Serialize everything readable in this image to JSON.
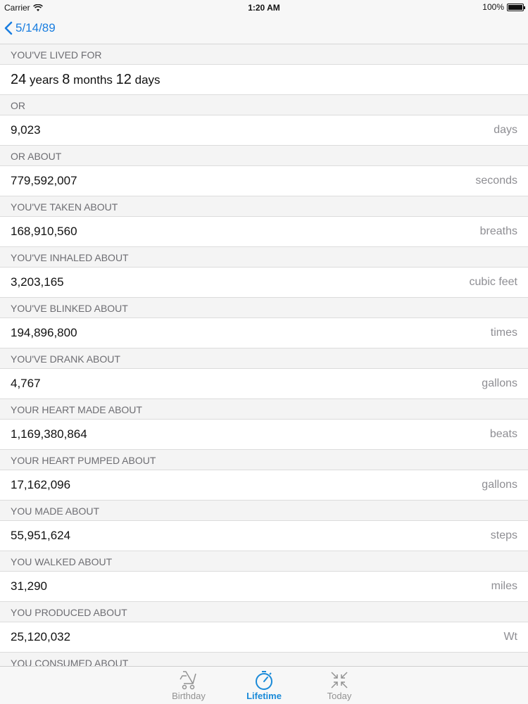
{
  "status_bar": {
    "carrier": "Carrier",
    "time": "1:20 AM",
    "battery": "100%"
  },
  "nav": {
    "back_label": "5/14/89"
  },
  "lived_for": {
    "header": "YOU'VE LIVED FOR",
    "years": "24",
    "years_word": "years",
    "months": "8",
    "months_word": "months",
    "days": "12",
    "days_word": "days"
  },
  "rows": [
    {
      "header": "OR",
      "value": "9,023",
      "unit": "days"
    },
    {
      "header": "OR ABOUT",
      "value": "779,592,007",
      "unit": "seconds"
    },
    {
      "header": "YOU'VE TAKEN ABOUT",
      "value": "168,910,560",
      "unit": "breaths"
    },
    {
      "header": "YOU'VE INHALED ABOUT",
      "value": "3,203,165",
      "unit": "cubic feet"
    },
    {
      "header": "YOU'VE BLINKED ABOUT",
      "value": "194,896,800",
      "unit": "times"
    },
    {
      "header": "YOU'VE DRANK ABOUT",
      "value": "4,767",
      "unit": "gallons"
    },
    {
      "header": "YOUR HEART MADE ABOUT",
      "value": "1,169,380,864",
      "unit": "beats"
    },
    {
      "header": "YOUR HEART PUMPED ABOUT",
      "value": "17,162,096",
      "unit": "gallons"
    },
    {
      "header": "YOU MADE ABOUT",
      "value": "55,951,624",
      "unit": "steps"
    },
    {
      "header": "YOU WALKED ABOUT",
      "value": "31,290",
      "unit": "miles"
    },
    {
      "header": "YOU PRODUCED ABOUT",
      "value": "25,120,032",
      "unit": "Wt"
    }
  ],
  "cut_header": "YOU CONSUMED ABOUT",
  "tabs": [
    {
      "label": "Birthday",
      "icon": "stroller-icon",
      "active": false
    },
    {
      "label": "Lifetime",
      "icon": "stopwatch-icon",
      "active": true
    },
    {
      "label": "Today",
      "icon": "arrows-inward-icon",
      "active": false
    }
  ],
  "colors": {
    "accent": "#1a8ad8",
    "inactive": "#929292",
    "header_text": "#6d6d72"
  }
}
